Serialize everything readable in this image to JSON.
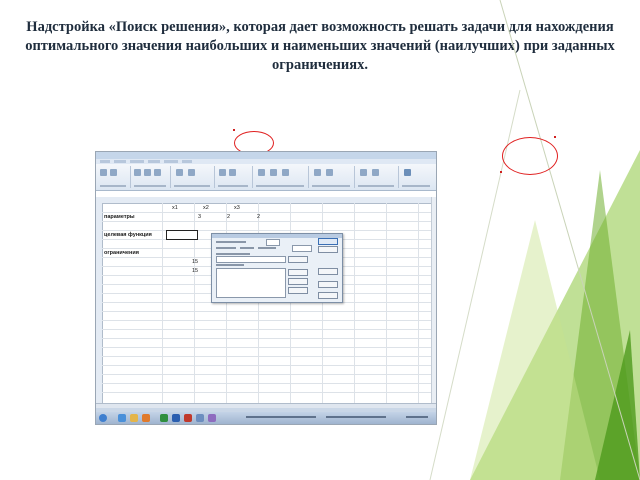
{
  "slide": {
    "title": "Надстройка «Поиск решения», которая дает возможность решать задачи для нахождения оптимального значения наибольших и наименьших значений (наилучших) при заданных ограничениях."
  },
  "colors": {
    "accent_green": "#8dc63f",
    "highlight_ring": "#e02020",
    "title_text": "#1f2d3d",
    "ribbon": "#dce6f2"
  },
  "spreadsheet": {
    "header_cells": [
      "x1",
      "x2",
      "x3"
    ],
    "rows": [
      {
        "label": "параметры",
        "values": [
          "3",
          "2",
          "2"
        ]
      },
      {
        "label": "целевая функция",
        "values": []
      },
      {
        "label": "ограничения",
        "values": [
          "15",
          "15"
        ]
      }
    ]
  }
}
